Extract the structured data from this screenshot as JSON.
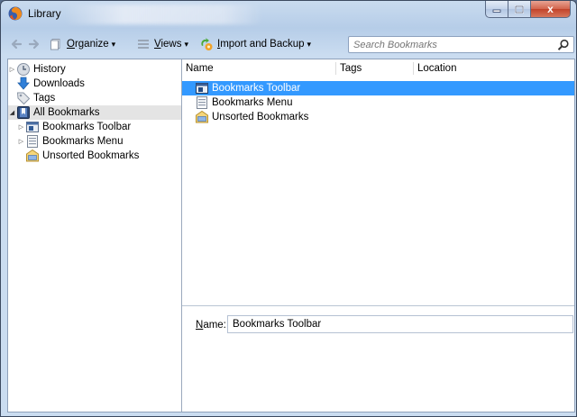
{
  "window": {
    "title": "Library",
    "buttons": {
      "minimize": "–",
      "maximize": "□",
      "close": "x"
    }
  },
  "toolbar": {
    "organize": "Organize",
    "organize_u": "O",
    "views": "Views",
    "views_u": "V",
    "import_backup": "Import and Backup",
    "import_backup_u": "I",
    "dropdown_marker": "▾"
  },
  "search": {
    "placeholder": "Search Bookmarks",
    "value": ""
  },
  "sidebar": {
    "items": [
      {
        "label": "History",
        "icon": "history-clock-icon",
        "expander": "collapsed"
      },
      {
        "label": "Downloads",
        "icon": "download-arrow-icon",
        "expander": "none"
      },
      {
        "label": "Tags",
        "icon": "tag-icon",
        "expander": "none"
      },
      {
        "label": "All Bookmarks",
        "icon": "all-bookmarks-icon",
        "expander": "expanded",
        "selected": true
      },
      {
        "label": "Bookmarks Toolbar",
        "icon": "bookmarks-toolbar-icon",
        "expander": "collapsed"
      },
      {
        "label": "Bookmarks Menu",
        "icon": "bookmarks-menu-icon",
        "expander": "collapsed"
      },
      {
        "label": "Unsorted Bookmarks",
        "icon": "unsorted-bookmarks-icon",
        "expander": "none"
      }
    ]
  },
  "table": {
    "columns": [
      "Name",
      "Tags",
      "Location"
    ],
    "rows": [
      {
        "name": "Bookmarks Toolbar",
        "icon": "bookmarks-toolbar-icon",
        "selected": true
      },
      {
        "name": "Bookmarks Menu",
        "icon": "bookmarks-menu-icon",
        "selected": false
      },
      {
        "name": "Unsorted Bookmarks",
        "icon": "unsorted-bookmarks-icon",
        "selected": false
      }
    ]
  },
  "details": {
    "name_label": "Name:",
    "name_label_u": "N",
    "name_value": "Bookmarks Toolbar"
  },
  "colors": {
    "selection": "#3399ff",
    "tree_selection": "#e4e4e4",
    "title_bar": "#b6cde8",
    "close_button": "#c2432a"
  }
}
